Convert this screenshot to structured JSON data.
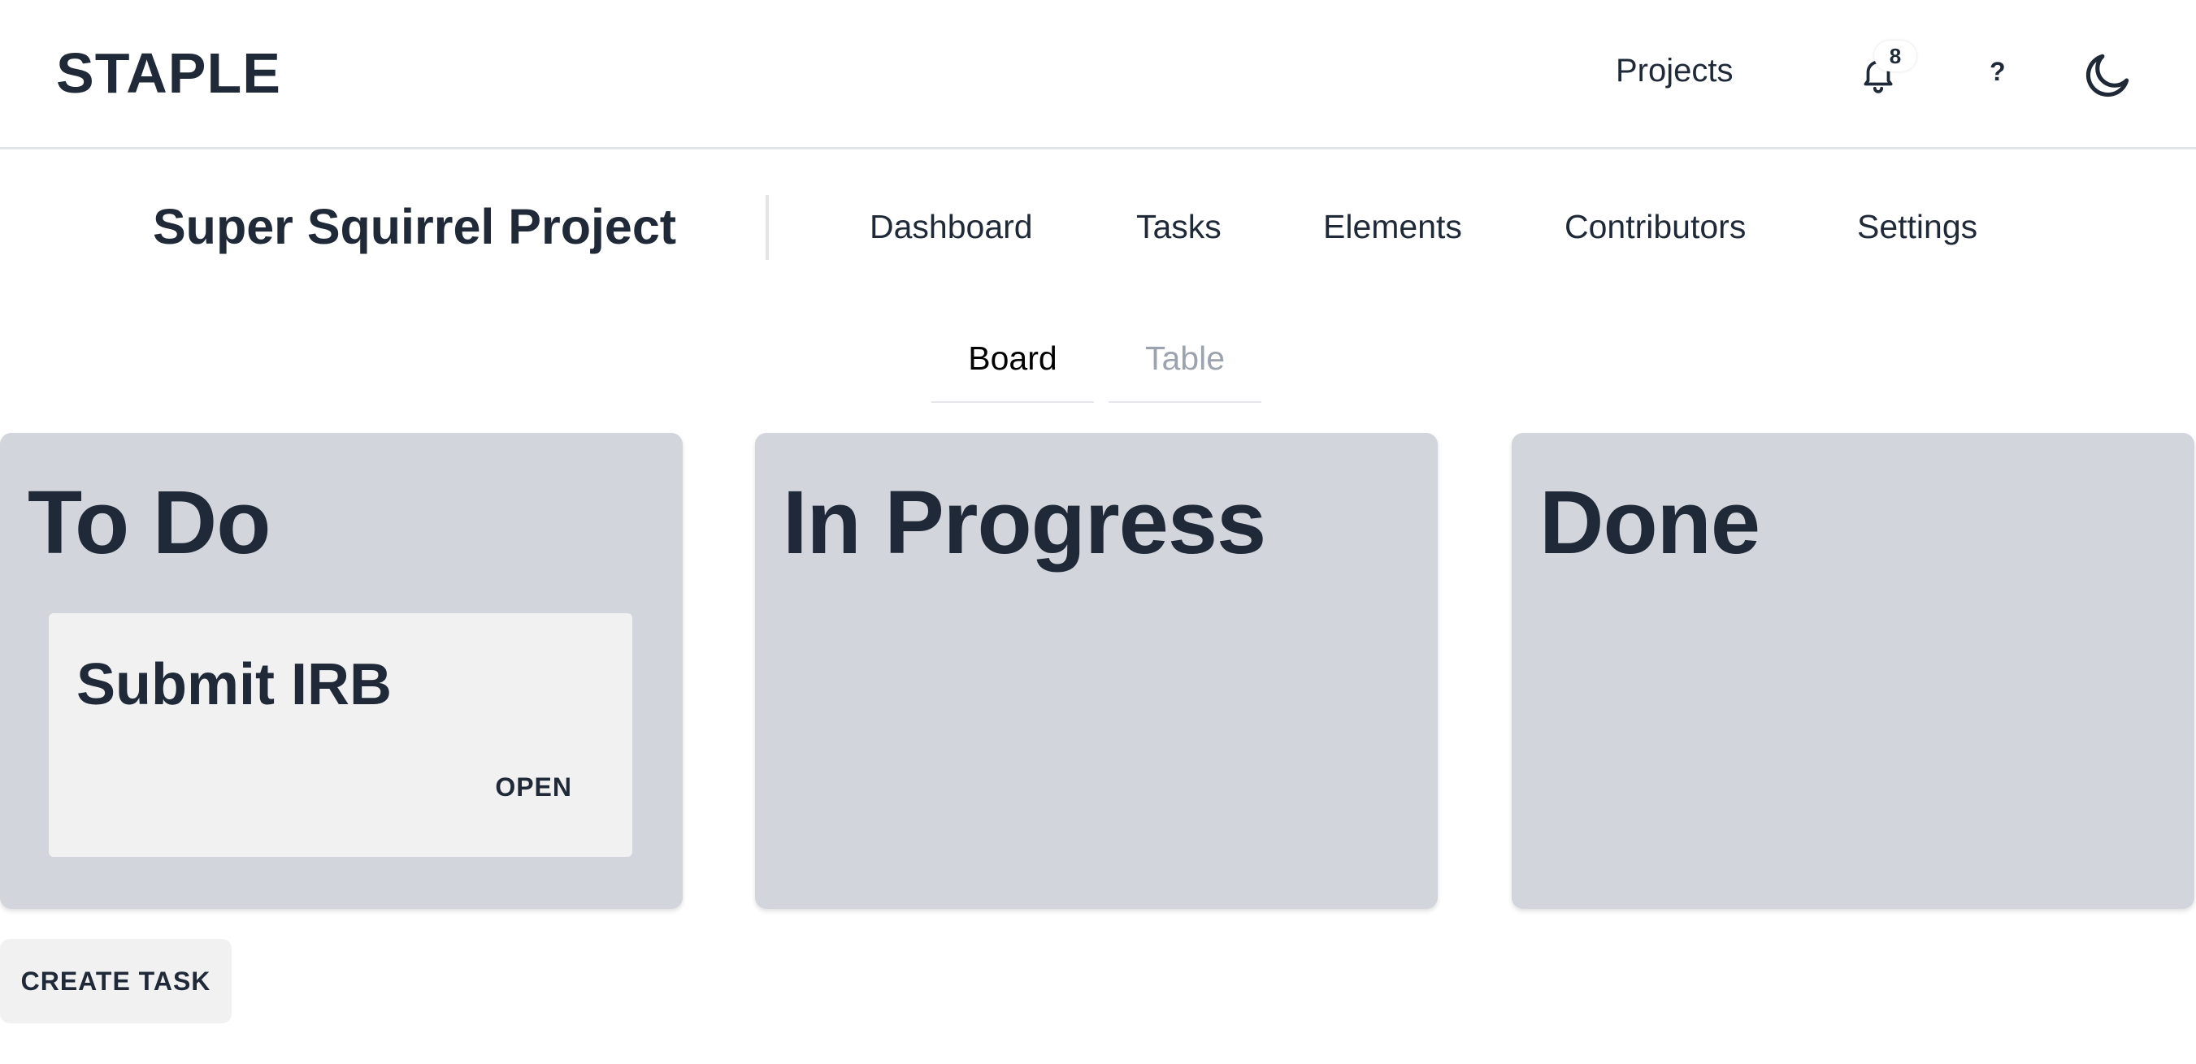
{
  "navbar": {
    "brand": "STAPLE",
    "projects_link": "Projects",
    "notification_count": "8",
    "help_label": "?",
    "icons": {
      "notifications": "bell-icon",
      "theme_toggle": "moon-icon"
    }
  },
  "project": {
    "title": "Super Squirrel Project",
    "nav": [
      "Dashboard",
      "Tasks",
      "Elements",
      "Contributors",
      "Settings"
    ]
  },
  "view_tabs": {
    "active": "Board",
    "items": [
      "Board",
      "Table"
    ]
  },
  "board": {
    "columns": [
      {
        "title": "To Do",
        "tasks": [
          {
            "title": "Submit IRB",
            "action": "OPEN"
          }
        ]
      },
      {
        "title": "In Progress",
        "tasks": []
      },
      {
        "title": "Done",
        "tasks": []
      }
    ]
  },
  "actions": {
    "create_task": "CREATE TASK"
  },
  "colors": {
    "text": "#1f2937",
    "column_bg": "#d2d5db",
    "card_bg": "#f1f1f2",
    "inactive_tab": "#9ca3af"
  }
}
